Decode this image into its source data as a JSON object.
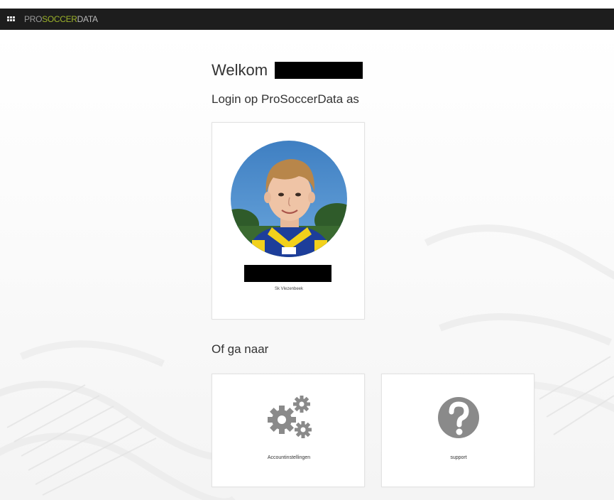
{
  "header": {
    "logo_pro": "PRO",
    "logo_soccer": "SOCCER",
    "logo_data": "DATA",
    "menu_icon": "apps-grid-icon"
  },
  "main": {
    "welcome": "Welkom",
    "login_as": "Login op ProSoccerData as",
    "profile": {
      "club": "Sk Vlezenbeek",
      "avatar": "user-photo"
    },
    "or_go": "Of ga naar",
    "tiles": [
      {
        "label": "Accountinstellingen",
        "icon": "gears-icon"
      },
      {
        "label": "support",
        "icon": "question-circle-icon"
      }
    ]
  },
  "colors": {
    "topbar": "#1d1d1d",
    "brand_green": "#9cb22b",
    "icon_gray": "#8a8a8a",
    "redaction": "#000000"
  }
}
